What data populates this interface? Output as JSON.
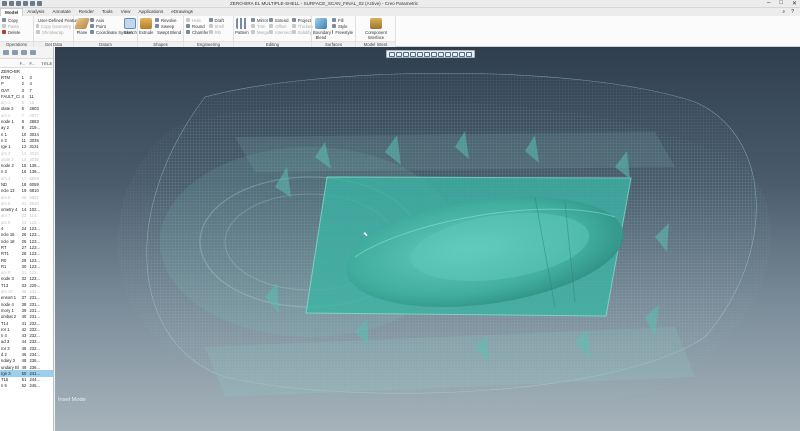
{
  "window": {
    "title": "ZERO-BRA EL MULTIPLE-SHELL - SURFACE_SCAN_FINAL_02 (Active) - Creo Parametric",
    "controls": [
      "–",
      "□",
      "✕"
    ]
  },
  "tabs": [
    "Model",
    "Analysis",
    "Annotate",
    "Render",
    "Tools",
    "View",
    "Applications",
    "eDrawings"
  ],
  "active_tab": "Model",
  "ribbon": {
    "operations": {
      "label": "Operations",
      "items": [
        "Copy",
        "Paste",
        "Delete"
      ]
    },
    "get_data": {
      "label": "Get Data",
      "items": [
        "User-Defined Feature",
        "Copy Geometry",
        "Shrinkwrap"
      ]
    },
    "datum": {
      "label": "Datum",
      "plane": "Plane",
      "items": [
        "Axis",
        "Point",
        "Coordinate System"
      ],
      "sketch": "Sketch"
    },
    "shapes": {
      "label": "Shapes",
      "extrude": "Extrude",
      "items": [
        "Revolve",
        "Sweep",
        "Swept Blend"
      ]
    },
    "engineering": {
      "label": "Engineering",
      "items": [
        "Hole",
        "Round",
        "Chamfer",
        "Draft",
        "Shell",
        "Rib"
      ]
    },
    "editing": {
      "label": "Editing",
      "pattern": "Pattern",
      "items": [
        "Mirror",
        "Trim",
        "Merge",
        "Extend",
        "Offset",
        "Intersect",
        "Project",
        "Thicken",
        "Solidify"
      ]
    },
    "surfaces": {
      "label": "Surfaces",
      "boundary": "Boundary Blend",
      "items": [
        "Fill",
        "Style",
        "Freestyle"
      ]
    },
    "model_intent": {
      "label": "Model Intent",
      "component": "Component Interface"
    }
  },
  "tree": {
    "columns": [
      "",
      "F...",
      "F...",
      "TITLE"
    ],
    "rows": [
      {
        "name": "ZERO-BRA",
        "a": "",
        "b": "",
        "dim": false
      },
      {
        "name": "RTM",
        "a": "1",
        "b": "3",
        "dim": false
      },
      {
        "name": "P",
        "a": "2",
        "b": "4",
        "dim": false
      },
      {
        "name": "OAT",
        "a": "3",
        "b": "7",
        "dim": false
      },
      {
        "name": "FAULT_CS",
        "a": "4",
        "b": "11",
        "dim": false
      },
      {
        "name": "am 1",
        "a": "5",
        "b": "15",
        "dim": true
      },
      {
        "name": "olate 2",
        "a": "6",
        "b": "2803",
        "dim": false
      },
      {
        "name": "am 2",
        "a": "7",
        "b": "2877",
        "dim": true
      },
      {
        "name": "node 1",
        "a": "8",
        "b": "2883",
        "dim": false
      },
      {
        "name": "ay 2",
        "a": "9",
        "b": "219...",
        "dim": false
      },
      {
        "name": "n 1",
        "a": "10",
        "b": "3024",
        "dim": false
      },
      {
        "name": "n 2",
        "a": "11",
        "b": "3035",
        "dim": false
      },
      {
        "name": "rge 1",
        "a": "12",
        "b": "3131",
        "dim": false
      },
      {
        "name": "am 3",
        "a": "13",
        "b": "4010",
        "dim": true
      },
      {
        "name": "olate 3",
        "a": "14",
        "b": "4039",
        "dim": true
      },
      {
        "name": "node 2",
        "a": "15",
        "b": "136...",
        "dim": false
      },
      {
        "name": "n 3",
        "a": "16",
        "b": "136...",
        "dim": false
      },
      {
        "name": "am 4",
        "a": "17",
        "b": "6959",
        "dim": true
      },
      {
        "name": "ND",
        "a": "18",
        "b": "6059",
        "dim": false
      },
      {
        "name": "ncle 13",
        "a": "19",
        "b": "6810",
        "dim": false
      },
      {
        "name": "am 5",
        "a": "20",
        "b": "6891",
        "dim": true
      },
      {
        "name": "am 6",
        "a": "21",
        "b": "6940",
        "dim": true
      },
      {
        "name": "ometry 4",
        "a": "14",
        "b": "102...",
        "dim": false
      },
      {
        "name": "am 7",
        "a": "22",
        "b": "114...",
        "dim": true
      },
      {
        "name": "am 8",
        "a": "23",
        "b": "123...",
        "dim": true
      },
      {
        "name": "4",
        "a": "24",
        "b": "123...",
        "dim": false
      },
      {
        "name": "ncle 16",
        "a": "26",
        "b": "123...",
        "dim": false
      },
      {
        "name": "ncle 18",
        "a": "26",
        "b": "123...",
        "dim": false
      },
      {
        "name": "RT",
        "a": "27",
        "b": "123...",
        "dim": false
      },
      {
        "name": "RT1",
        "a": "28",
        "b": "123...",
        "dim": false
      },
      {
        "name": "R0",
        "a": "29",
        "b": "123...",
        "dim": false
      },
      {
        "name": "R1",
        "a": "30",
        "b": "123...",
        "dim": false
      },
      {
        "name": "am 9",
        "a": "31",
        "b": "123...",
        "dim": true
      },
      {
        "name": "node 3",
        "a": "32",
        "b": "123...",
        "dim": false
      },
      {
        "name": "T13",
        "a": "33",
        "b": "229...",
        "dim": false
      },
      {
        "name": "am 10",
        "a": "36",
        "b": "231...",
        "dim": true
      },
      {
        "name": "ensort 1",
        "a": "37",
        "b": "231...",
        "dim": false
      },
      {
        "name": "node 4",
        "a": "38",
        "b": "231...",
        "dim": false
      },
      {
        "name": "mory 1",
        "a": "39",
        "b": "231...",
        "dim": false
      },
      {
        "name": "ombat 2",
        "a": "40",
        "b": "231...",
        "dim": false
      },
      {
        "name": "T14",
        "a": "41",
        "b": "232...",
        "dim": false
      },
      {
        "name": "ror 1",
        "a": "42",
        "b": "232...",
        "dim": false
      },
      {
        "name": "n 4",
        "a": "43",
        "b": "232...",
        "dim": false
      },
      {
        "name": "ad 3",
        "a": "44",
        "b": "232...",
        "dim": false
      },
      {
        "name": "ror 3",
        "a": "45",
        "b": "232...",
        "dim": false
      },
      {
        "name": "d 2",
        "a": "46",
        "b": "234...",
        "dim": false
      },
      {
        "name": "ndary 3",
        "a": "48",
        "b": "236...",
        "dim": false
      },
      {
        "name": "undary Bl",
        "a": "49",
        "b": "236...",
        "dim": false
      },
      {
        "name": "rge 3",
        "a": "50",
        "b": "241...",
        "dim": false
      },
      {
        "name": "T15",
        "a": "51",
        "b": "244...",
        "dim": false
      },
      {
        "name": "n 5",
        "a": "52",
        "b": "245...",
        "dim": false
      }
    ],
    "selected_index": 48
  },
  "graphics": {
    "mode_text": "Inset Mode",
    "surface_color": "#4fc1b3",
    "plane_color": "#3ab5a6"
  }
}
